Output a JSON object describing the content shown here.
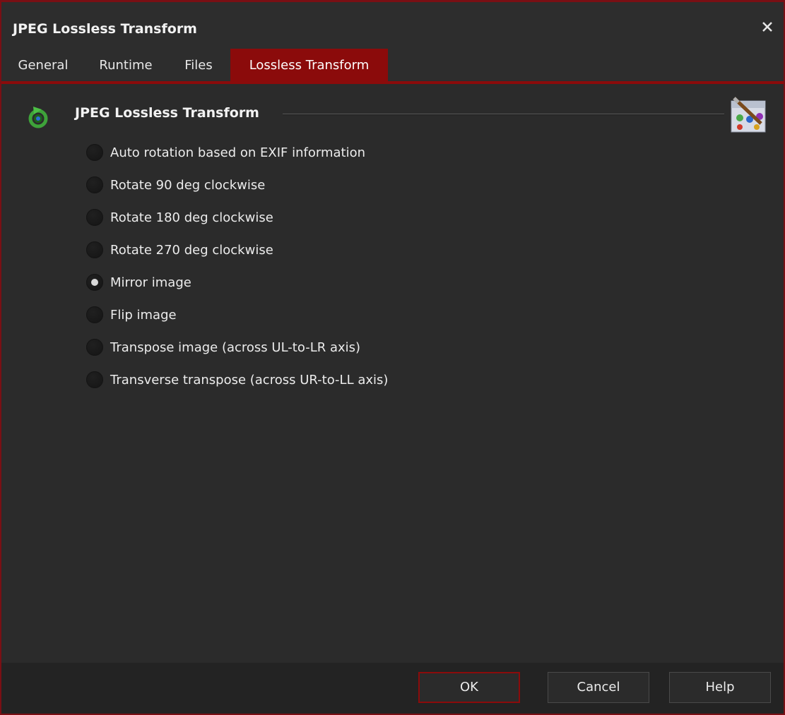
{
  "window": {
    "title": "JPEG Lossless Transform"
  },
  "tabs": [
    {
      "label": "General"
    },
    {
      "label": "Runtime"
    },
    {
      "label": "Files"
    },
    {
      "label": "Lossless Transform",
      "active": true
    }
  ],
  "group": {
    "title": "JPEG Lossless Transform"
  },
  "options": [
    {
      "label": "Auto rotation based on EXIF information",
      "checked": false
    },
    {
      "label": "Rotate 90 deg clockwise",
      "checked": false
    },
    {
      "label": "Rotate 180 deg clockwise",
      "checked": false
    },
    {
      "label": "Rotate 270 deg clockwise",
      "checked": false
    },
    {
      "label": "Mirror image",
      "checked": true
    },
    {
      "label": "Flip image",
      "checked": false
    },
    {
      "label": "Transpose image (across UL-to-LR axis)",
      "checked": false
    },
    {
      "label": "Transverse transpose (across UR-to-LL axis)",
      "checked": false
    }
  ],
  "buttons": {
    "ok": "OK",
    "cancel": "Cancel",
    "help": "Help"
  },
  "colors": {
    "accent": "#8b0b0b",
    "background": "#2b2b2b",
    "text": "#ececec"
  },
  "icons": {
    "close": "close-icon",
    "tab_menu": "menu-dropdown-icon",
    "group": "rotate-icon",
    "action": "image-transform-icon"
  }
}
